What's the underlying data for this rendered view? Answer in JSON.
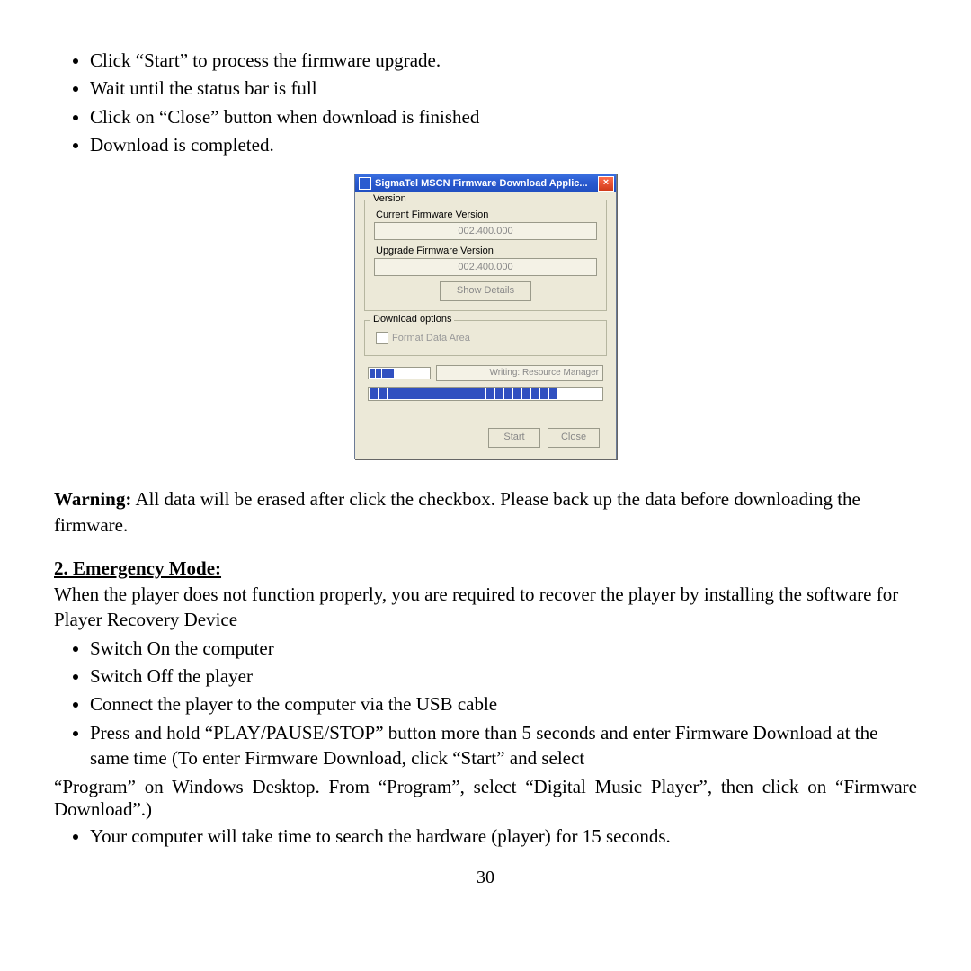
{
  "top_bullets": [
    "Click “Start” to process the firmware upgrade.",
    "Wait until the status bar is full",
    "Click on “Close” button when download is finished",
    "Download is completed."
  ],
  "dialog": {
    "title": "SigmaTel MSCN Firmware Download Applic...",
    "version_group": "Version",
    "current_label": "Current Firmware Version",
    "current_value": "002.400.000",
    "upgrade_label": "Upgrade Firmware Version",
    "upgrade_value": "002.400.000",
    "show_details": "Show Details",
    "download_group": "Download options",
    "format_checkbox": "Format Data Area",
    "status_text": "Writing: Resource Manager",
    "start_button": "Start",
    "close_button": "Close",
    "sub_progress_segments": 4,
    "main_progress_filled": 21,
    "main_progress_total": 24
  },
  "warning_lead": "Warning:",
  "warning_text": " All data will be erased after click the checkbox. Please back up the data before downloading the firmware.",
  "emergency_title": "2. Emergency Mode:",
  "emergency_intro": "When the player does not function properly, you are required to recover the player by installing the software for Player Recovery Device",
  "emergency_bullets": [
    "Switch On the computer",
    "Switch Off the player",
    "Connect the player to the computer via the USB cable",
    "Press and hold “PLAY/PAUSE/STOP” button more than 5 seconds and enter Firmware Download at the same time (To enter Firmware Download, click “Start” and select"
  ],
  "emergency_cont": "“Program” on Windows Desktop. From “Program”, select “Digital Music Player”, then click on “Firmware Download”.)",
  "emergency_last_bullet": "Your computer will take time to search the hardware (player) for 15 seconds.",
  "page_number": "30"
}
